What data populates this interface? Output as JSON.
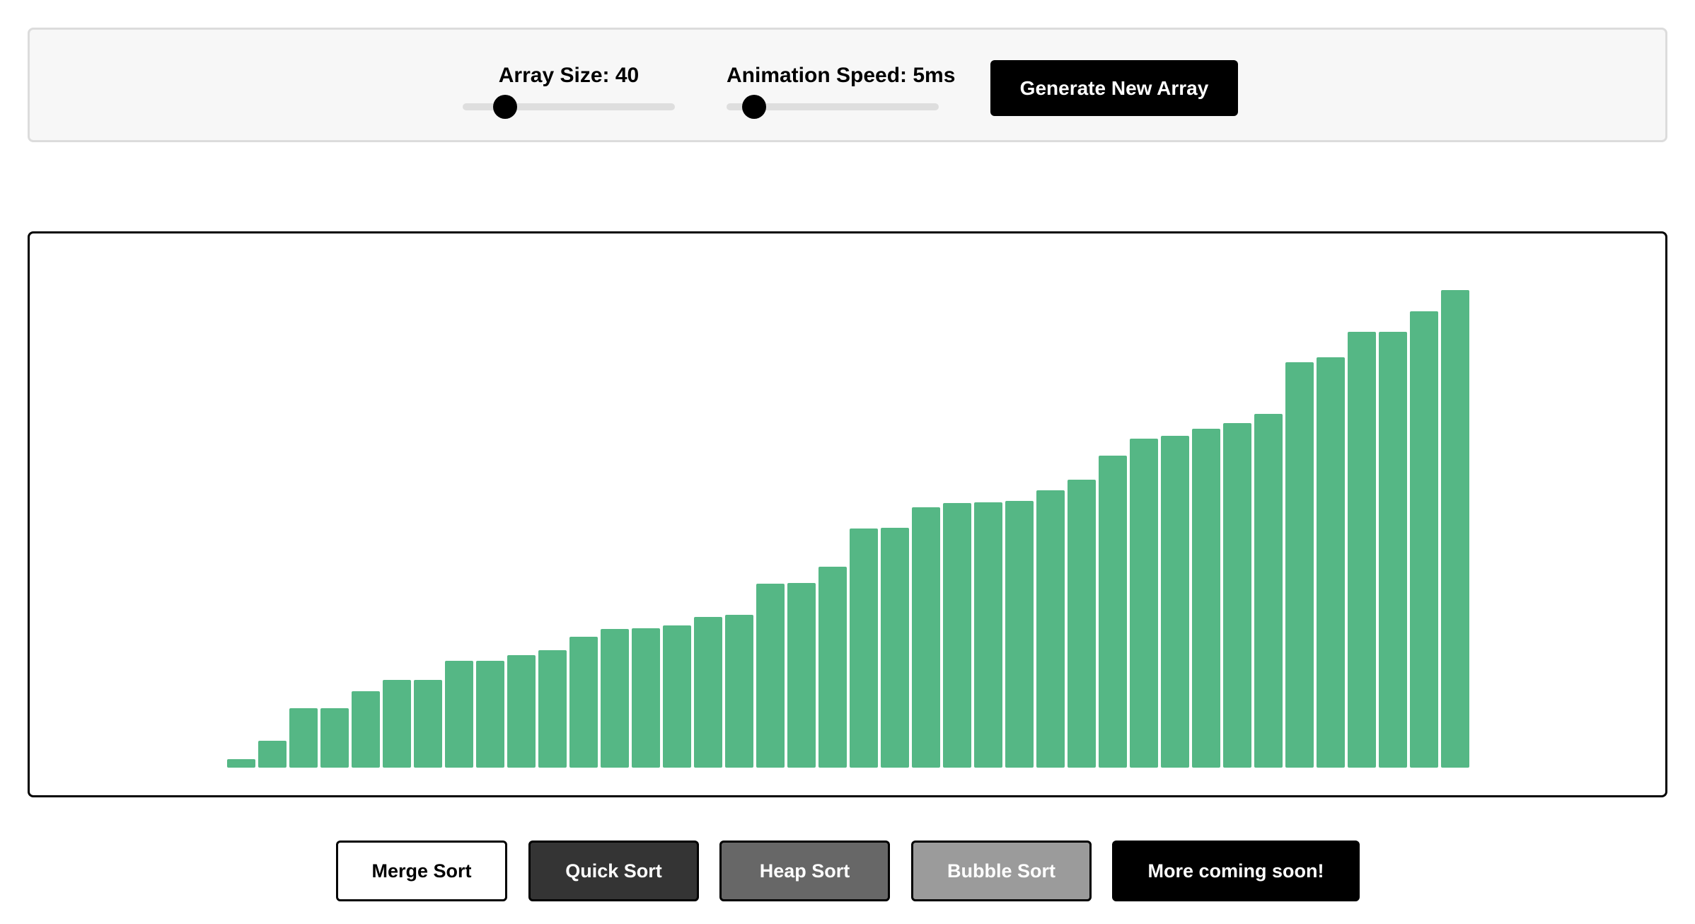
{
  "controls": {
    "array_size_label": "Array Size: 40",
    "array_size_value": 40,
    "array_size_fraction": 0.2,
    "speed_label": "Animation Speed: 5ms",
    "speed_value_ms": 5,
    "speed_fraction": 0.13,
    "generate_label": "Generate New Array"
  },
  "chart_data": {
    "type": "bar",
    "bar_color": "#55b785",
    "values": [
      12,
      38,
      84,
      84,
      108,
      124,
      124,
      151,
      151,
      159,
      166,
      185,
      196,
      197,
      201,
      213,
      216,
      260,
      261,
      284,
      338,
      339,
      368,
      374,
      375,
      377,
      392,
      407,
      441,
      465,
      469,
      479,
      487,
      500,
      573,
      580,
      616,
      616,
      645,
      675
    ],
    "ylim": [
      0,
      675
    ]
  },
  "sort_buttons": [
    {
      "label": "Merge Sort",
      "color": "#ffffff"
    },
    {
      "label": "Quick Sort",
      "color": "#343434"
    },
    {
      "label": "Heap Sort",
      "color": "#676767"
    },
    {
      "label": "Bubble Sort",
      "color": "#9b9b9b"
    },
    {
      "label": "More coming soon!",
      "color": "#000000"
    }
  ]
}
